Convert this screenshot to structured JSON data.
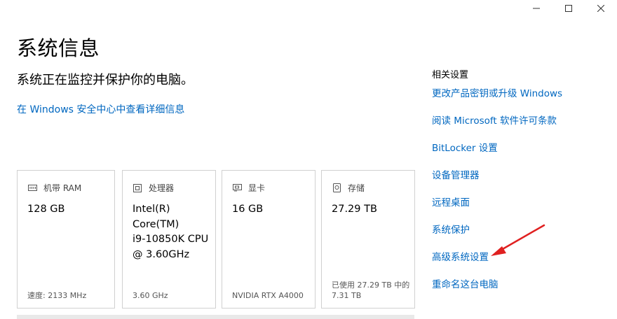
{
  "window": {
    "minimize_glyph": "—",
    "maximize_glyph": "☐",
    "close_glyph": "✕"
  },
  "page": {
    "title": "系统信息",
    "subtitle": "系统正在监控并保护你的电脑。",
    "security_link": "在 Windows 安全中心中查看详细信息"
  },
  "cards": [
    {
      "icon": "ram-icon",
      "label": "机带 RAM",
      "value": "128 GB",
      "footer": "速度: 2133 MHz"
    },
    {
      "icon": "processor-icon",
      "label": "处理器",
      "value": "Intel(R)\nCore(TM)\ni9-10850K CPU\n@ 3.60GHz",
      "footer": "3.60 GHz"
    },
    {
      "icon": "gpu-icon",
      "label": "显卡",
      "value": "16 GB",
      "footer": "NVIDIA RTX A4000"
    },
    {
      "icon": "storage-icon",
      "label": "存储",
      "value": "27.29 TB",
      "footer": "已使用 27.29 TB 中的\n7.31 TB"
    }
  ],
  "related": {
    "heading": "相关设置",
    "links": [
      "更改产品密钥或升级 Windows",
      "阅读 Microsoft 软件许可条款",
      "BitLocker 设置",
      "设备管理器",
      "远程桌面",
      "系统保护",
      "高级系统设置",
      "重命名这台电脑"
    ]
  },
  "colors": {
    "link": "#0067c0",
    "annotation_arrow": "#e02020",
    "card_border": "#d0d0d0"
  }
}
